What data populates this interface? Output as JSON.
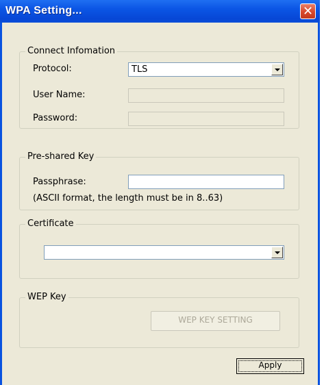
{
  "window": {
    "title": "WPA Setting..."
  },
  "connect": {
    "legend": "Connect Infomation",
    "protocol_label": "Protocol:",
    "protocol_value": "TLS",
    "username_label": "User Name:",
    "username_value": "",
    "password_label": "Password:",
    "password_value": ""
  },
  "psk": {
    "legend": "Pre-shared Key",
    "passphrase_label": "Passphrase:",
    "passphrase_value": "",
    "hint": "(ASCII format, the length must be in 8..63)"
  },
  "certificate": {
    "legend": "Certificate",
    "selected": ""
  },
  "wep": {
    "legend": "WEP Key",
    "button_label": "WEP KEY SETTING"
  },
  "actions": {
    "apply_label": "Apply"
  }
}
